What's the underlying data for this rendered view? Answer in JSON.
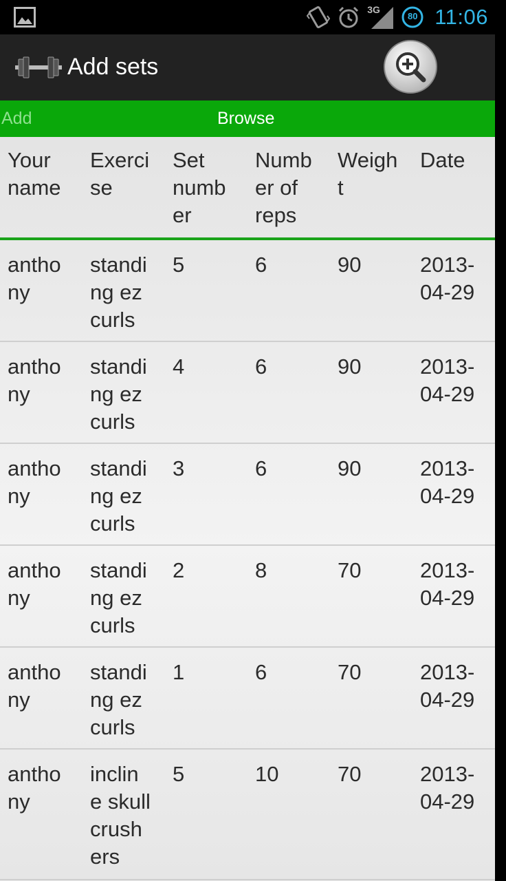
{
  "status_bar": {
    "time": "11:06",
    "network": "3G",
    "battery": "80",
    "icons": [
      "gallery-icon",
      "vibrate-icon",
      "alarm-icon",
      "signal-icon",
      "battery-icon"
    ],
    "accent": "#33b5e5"
  },
  "action_bar": {
    "title": "Add sets",
    "icons": [
      "dumbbell-icon",
      "zoom-in-icon"
    ]
  },
  "tabs": [
    {
      "label": "Add"
    },
    {
      "label": "Browse"
    }
  ],
  "colors": {
    "tab_bar": "#0aa80a",
    "action_bar": "#222222",
    "divider": "#1aa31a"
  },
  "table": {
    "headers": [
      "Your name",
      "Exercise",
      "Set number",
      "Number of reps",
      "Weight",
      "Date"
    ],
    "header_display": [
      "Your\nname",
      "Exerci\nse",
      "Set\nnumb\ner",
      "Numb\ner of\nreps",
      "Weigh\nt",
      "Date"
    ],
    "rows": [
      [
        "anthony",
        "standing ez curls",
        "5",
        "6",
        "90",
        "2013-04-29"
      ],
      [
        "anthony",
        "standing ez curls",
        "4",
        "6",
        "90",
        "2013-04-29"
      ],
      [
        "anthony",
        "standing ez curls",
        "3",
        "6",
        "90",
        "2013-04-29"
      ],
      [
        "anthony",
        "standing ez curls",
        "2",
        "8",
        "70",
        "2013-04-29"
      ],
      [
        "anthony",
        "standing ez curls",
        "1",
        "6",
        "70",
        "2013-04-29"
      ],
      [
        "anthony",
        "incline skull crushers",
        "5",
        "10",
        "70",
        "2013-04-29"
      ]
    ],
    "rows_display": [
      [
        "antho\nny",
        "standi\nng ez\ncurls",
        "5",
        "6",
        "90",
        "2013-\n04-29"
      ],
      [
        "antho\nny",
        "standi\nng ez\ncurls",
        "4",
        "6",
        "90",
        "2013-\n04-29"
      ],
      [
        "antho\nny",
        "standi\nng ez\ncurls",
        "3",
        "6",
        "90",
        "2013-\n04-29"
      ],
      [
        "antho\nny",
        "standi\nng ez\ncurls",
        "2",
        "8",
        "70",
        "2013-\n04-29"
      ],
      [
        "antho\nny",
        "standi\nng ez\ncurls",
        "1",
        "6",
        "70",
        "2013-\n04-29"
      ],
      [
        "antho\nny",
        "inclin\ne skull\ncrush\ners",
        "5",
        "10",
        "70",
        "2013-\n04-29"
      ]
    ]
  }
}
